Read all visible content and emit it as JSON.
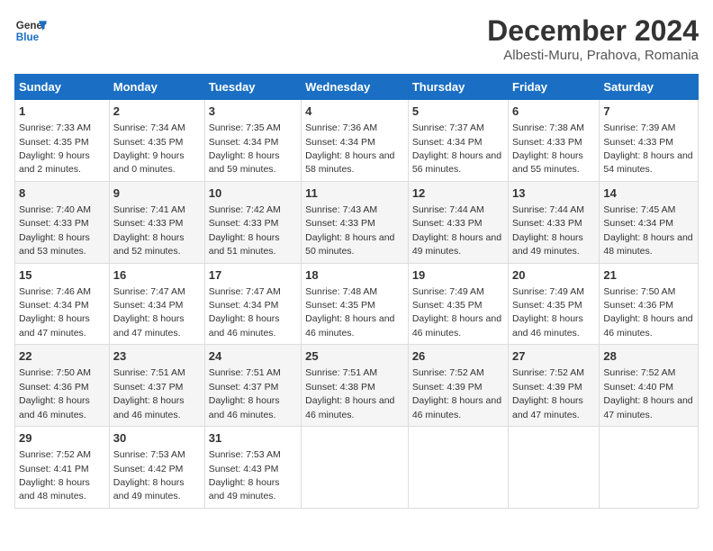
{
  "logo": {
    "line1": "General",
    "line2": "Blue"
  },
  "title": "December 2024",
  "location": "Albesti-Muru, Prahova, Romania",
  "days_of_week": [
    "Sunday",
    "Monday",
    "Tuesday",
    "Wednesday",
    "Thursday",
    "Friday",
    "Saturday"
  ],
  "weeks": [
    [
      {
        "day": "1",
        "sunrise": "Sunrise: 7:33 AM",
        "sunset": "Sunset: 4:35 PM",
        "daylight": "Daylight: 9 hours and 2 minutes."
      },
      {
        "day": "2",
        "sunrise": "Sunrise: 7:34 AM",
        "sunset": "Sunset: 4:35 PM",
        "daylight": "Daylight: 9 hours and 0 minutes."
      },
      {
        "day": "3",
        "sunrise": "Sunrise: 7:35 AM",
        "sunset": "Sunset: 4:34 PM",
        "daylight": "Daylight: 8 hours and 59 minutes."
      },
      {
        "day": "4",
        "sunrise": "Sunrise: 7:36 AM",
        "sunset": "Sunset: 4:34 PM",
        "daylight": "Daylight: 8 hours and 58 minutes."
      },
      {
        "day": "5",
        "sunrise": "Sunrise: 7:37 AM",
        "sunset": "Sunset: 4:34 PM",
        "daylight": "Daylight: 8 hours and 56 minutes."
      },
      {
        "day": "6",
        "sunrise": "Sunrise: 7:38 AM",
        "sunset": "Sunset: 4:33 PM",
        "daylight": "Daylight: 8 hours and 55 minutes."
      },
      {
        "day": "7",
        "sunrise": "Sunrise: 7:39 AM",
        "sunset": "Sunset: 4:33 PM",
        "daylight": "Daylight: 8 hours and 54 minutes."
      }
    ],
    [
      {
        "day": "8",
        "sunrise": "Sunrise: 7:40 AM",
        "sunset": "Sunset: 4:33 PM",
        "daylight": "Daylight: 8 hours and 53 minutes."
      },
      {
        "day": "9",
        "sunrise": "Sunrise: 7:41 AM",
        "sunset": "Sunset: 4:33 PM",
        "daylight": "Daylight: 8 hours and 52 minutes."
      },
      {
        "day": "10",
        "sunrise": "Sunrise: 7:42 AM",
        "sunset": "Sunset: 4:33 PM",
        "daylight": "Daylight: 8 hours and 51 minutes."
      },
      {
        "day": "11",
        "sunrise": "Sunrise: 7:43 AM",
        "sunset": "Sunset: 4:33 PM",
        "daylight": "Daylight: 8 hours and 50 minutes."
      },
      {
        "day": "12",
        "sunrise": "Sunrise: 7:44 AM",
        "sunset": "Sunset: 4:33 PM",
        "daylight": "Daylight: 8 hours and 49 minutes."
      },
      {
        "day": "13",
        "sunrise": "Sunrise: 7:44 AM",
        "sunset": "Sunset: 4:33 PM",
        "daylight": "Daylight: 8 hours and 49 minutes."
      },
      {
        "day": "14",
        "sunrise": "Sunrise: 7:45 AM",
        "sunset": "Sunset: 4:34 PM",
        "daylight": "Daylight: 8 hours and 48 minutes."
      }
    ],
    [
      {
        "day": "15",
        "sunrise": "Sunrise: 7:46 AM",
        "sunset": "Sunset: 4:34 PM",
        "daylight": "Daylight: 8 hours and 47 minutes."
      },
      {
        "day": "16",
        "sunrise": "Sunrise: 7:47 AM",
        "sunset": "Sunset: 4:34 PM",
        "daylight": "Daylight: 8 hours and 47 minutes."
      },
      {
        "day": "17",
        "sunrise": "Sunrise: 7:47 AM",
        "sunset": "Sunset: 4:34 PM",
        "daylight": "Daylight: 8 hours and 46 minutes."
      },
      {
        "day": "18",
        "sunrise": "Sunrise: 7:48 AM",
        "sunset": "Sunset: 4:35 PM",
        "daylight": "Daylight: 8 hours and 46 minutes."
      },
      {
        "day": "19",
        "sunrise": "Sunrise: 7:49 AM",
        "sunset": "Sunset: 4:35 PM",
        "daylight": "Daylight: 8 hours and 46 minutes."
      },
      {
        "day": "20",
        "sunrise": "Sunrise: 7:49 AM",
        "sunset": "Sunset: 4:35 PM",
        "daylight": "Daylight: 8 hours and 46 minutes."
      },
      {
        "day": "21",
        "sunrise": "Sunrise: 7:50 AM",
        "sunset": "Sunset: 4:36 PM",
        "daylight": "Daylight: 8 hours and 46 minutes."
      }
    ],
    [
      {
        "day": "22",
        "sunrise": "Sunrise: 7:50 AM",
        "sunset": "Sunset: 4:36 PM",
        "daylight": "Daylight: 8 hours and 46 minutes."
      },
      {
        "day": "23",
        "sunrise": "Sunrise: 7:51 AM",
        "sunset": "Sunset: 4:37 PM",
        "daylight": "Daylight: 8 hours and 46 minutes."
      },
      {
        "day": "24",
        "sunrise": "Sunrise: 7:51 AM",
        "sunset": "Sunset: 4:37 PM",
        "daylight": "Daylight: 8 hours and 46 minutes."
      },
      {
        "day": "25",
        "sunrise": "Sunrise: 7:51 AM",
        "sunset": "Sunset: 4:38 PM",
        "daylight": "Daylight: 8 hours and 46 minutes."
      },
      {
        "day": "26",
        "sunrise": "Sunrise: 7:52 AM",
        "sunset": "Sunset: 4:39 PM",
        "daylight": "Daylight: 8 hours and 46 minutes."
      },
      {
        "day": "27",
        "sunrise": "Sunrise: 7:52 AM",
        "sunset": "Sunset: 4:39 PM",
        "daylight": "Daylight: 8 hours and 47 minutes."
      },
      {
        "day": "28",
        "sunrise": "Sunrise: 7:52 AM",
        "sunset": "Sunset: 4:40 PM",
        "daylight": "Daylight: 8 hours and 47 minutes."
      }
    ],
    [
      {
        "day": "29",
        "sunrise": "Sunrise: 7:52 AM",
        "sunset": "Sunset: 4:41 PM",
        "daylight": "Daylight: 8 hours and 48 minutes."
      },
      {
        "day": "30",
        "sunrise": "Sunrise: 7:53 AM",
        "sunset": "Sunset: 4:42 PM",
        "daylight": "Daylight: 8 hours and 49 minutes."
      },
      {
        "day": "31",
        "sunrise": "Sunrise: 7:53 AM",
        "sunset": "Sunset: 4:43 PM",
        "daylight": "Daylight: 8 hours and 49 minutes."
      },
      null,
      null,
      null,
      null
    ]
  ]
}
